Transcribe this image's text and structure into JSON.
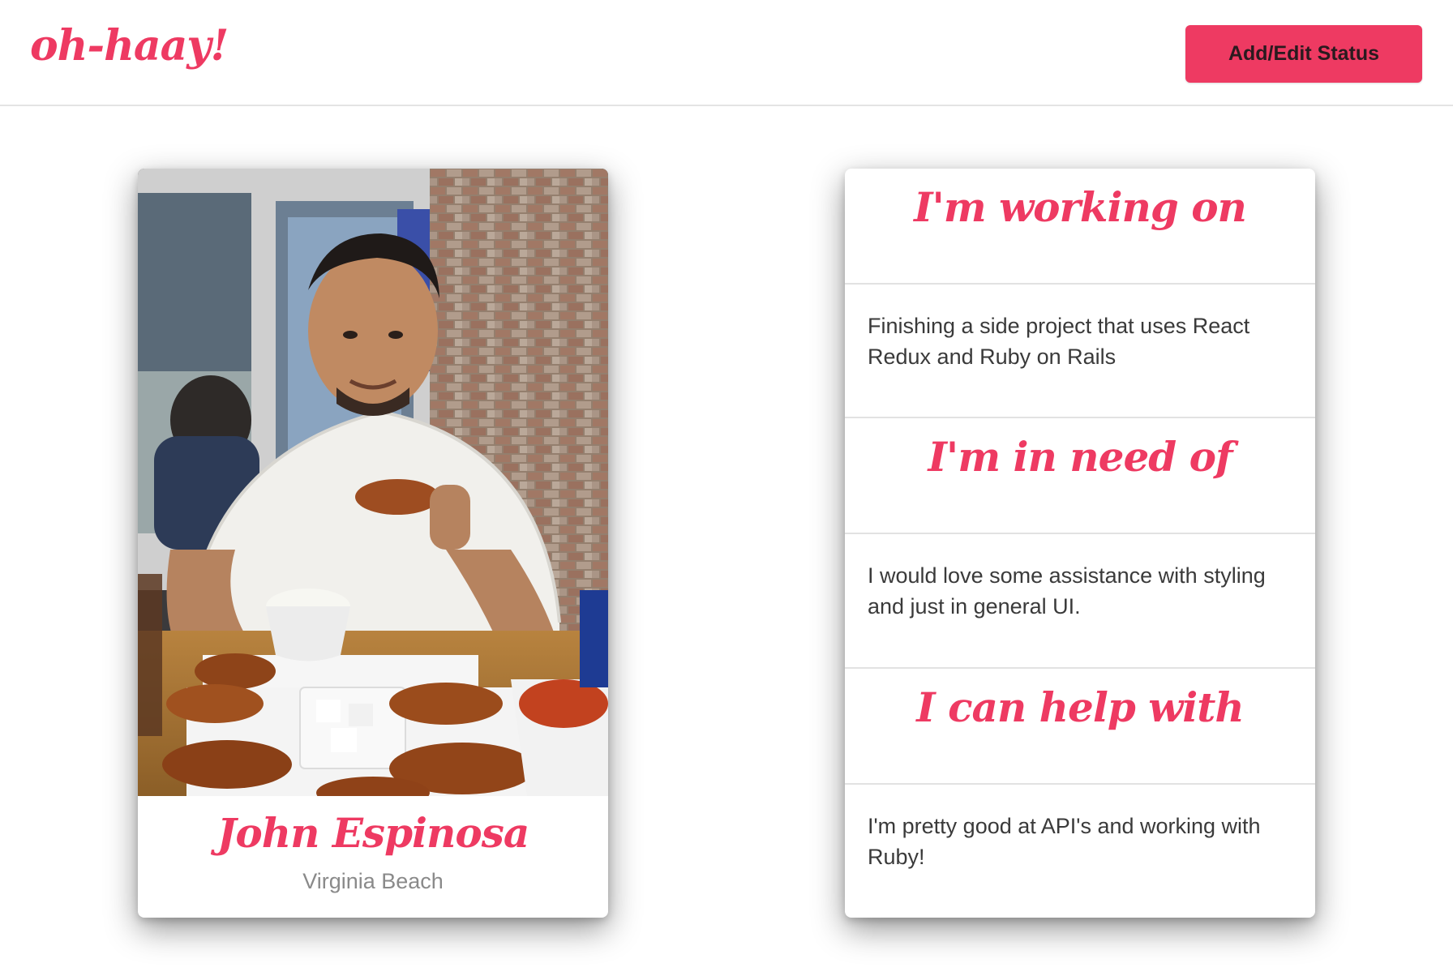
{
  "header": {
    "brand": "oh-haay!",
    "status_button_label": "Add/Edit Status"
  },
  "profile": {
    "photo_alt": "photo",
    "name": "John Espinosa",
    "location": "Virginia Beach"
  },
  "status": {
    "sections": [
      {
        "heading": "I'm working on",
        "body": "Finishing a side project that uses React Redux and Ruby on Rails"
      },
      {
        "heading": "I'm in need of",
        "body": "I would love some assistance with styling and just in general UI."
      },
      {
        "heading": "I can help with",
        "body": "I'm pretty good at API's and working with Ruby!"
      }
    ]
  },
  "colors": {
    "accent": "#ee3a62",
    "text": "#3a3a3a",
    "muted": "#8a8a8a",
    "divider": "#e2e2e2"
  }
}
